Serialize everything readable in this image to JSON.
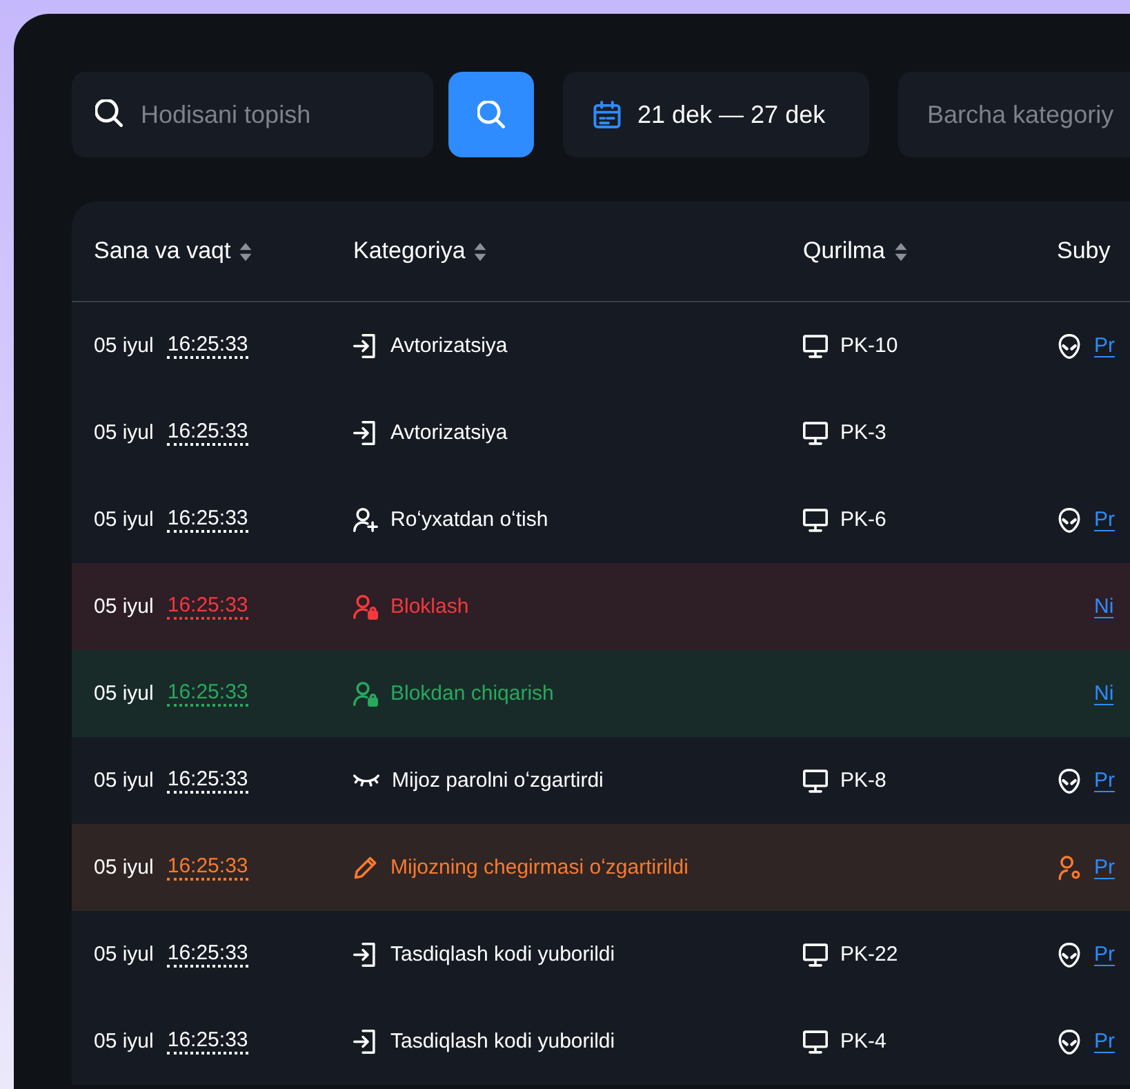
{
  "toolbar": {
    "search": {
      "placeholder": "Hodisani topish"
    },
    "date_range": "21 dek — 27 dek",
    "category_filter": {
      "placeholder": "Barcha kategoriy"
    }
  },
  "table": {
    "columns": [
      "Sana va vaqt",
      "Kategoriya",
      "Qurilma",
      "Suby"
    ],
    "rows": [
      {
        "date": "05 iyul",
        "time": "16:25:33",
        "category": {
          "kind": "login",
          "text": "Avtorizatsiya"
        },
        "device": "PK-10",
        "subject": {
          "kind": "alien",
          "link": "Pr"
        }
      },
      {
        "date": "05 iyul",
        "time": "16:25:33",
        "category": {
          "kind": "login",
          "text": "Avtorizatsiya"
        },
        "device": "PK-3"
      },
      {
        "date": "05 iyul",
        "time": "16:25:33",
        "category": {
          "kind": "user-add",
          "text": "Roʻyxatdan oʻtish"
        },
        "device": "PK-6",
        "subject": {
          "kind": "alien",
          "link": "Pr"
        }
      },
      {
        "color": "#f4393c",
        "date": "05 iyul",
        "time": "16:25:33",
        "category": {
          "kind": "user-lock",
          "text": "Bloklash"
        },
        "subject": {
          "kind": "link",
          "link": "Ni"
        }
      },
      {
        "color": "#28a85d",
        "date": "05 iyul",
        "time": "16:25:33",
        "category": {
          "kind": "user-lock",
          "text": "Blokdan chiqarish"
        },
        "subject": {
          "kind": "link",
          "link": "Ni"
        }
      },
      {
        "date": "05 iyul",
        "time": "16:25:33",
        "category": {
          "kind": "eye-closed",
          "text": "Mijoz parolni oʻzgartirdi"
        },
        "device": "PK-8",
        "subject": {
          "kind": "alien",
          "link": "Pr"
        }
      },
      {
        "color": "#fb7a2e",
        "date": "05 iyul",
        "time": "16:25:33",
        "category": {
          "kind": "pencil",
          "text": "Mijozning chegirmasi oʻzgartirildi"
        },
        "subject": {
          "kind": "user-gear",
          "link": "Pr"
        }
      },
      {
        "date": "05 iyul",
        "time": "16:25:33",
        "category": {
          "kind": "login",
          "text": "Tasdiqlash kodi yuborildi"
        },
        "device": "PK-22",
        "subject": {
          "kind": "alien",
          "link": "Pr"
        }
      },
      {
        "date": "05 iyul",
        "time": "16:25:33",
        "category": {
          "kind": "login",
          "text": "Tasdiqlash kodi yuborildi"
        },
        "device": "PK-4",
        "subject": {
          "kind": "alien",
          "link": "Pr"
        }
      }
    ]
  }
}
